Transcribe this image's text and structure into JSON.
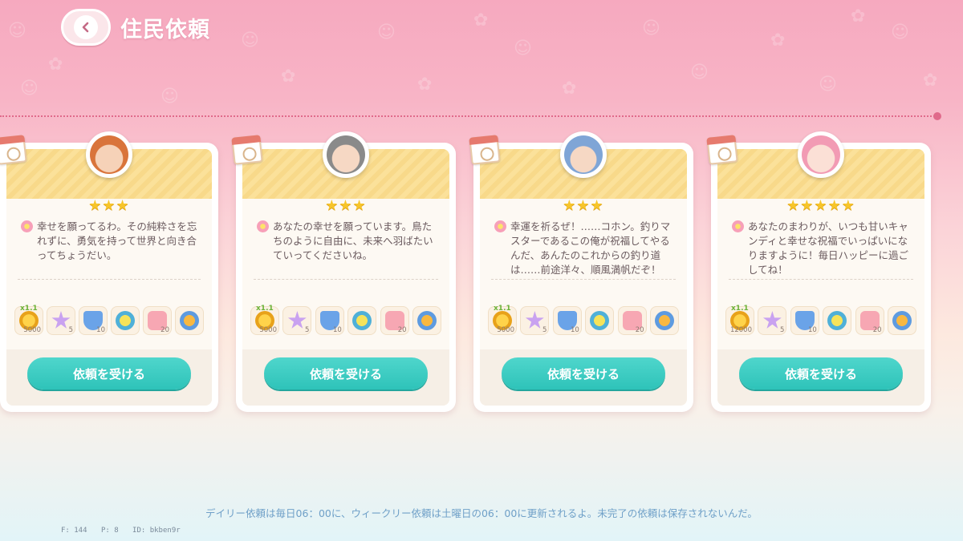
{
  "header": {
    "title": "住民依頼"
  },
  "cards": [
    {
      "stars": "★★★",
      "message": "幸せを願ってるわ。その純粋さを忘れずに、勇気を持って世界と向き合ってちょうだい。",
      "rewards": [
        {
          "icon": "coin-icon",
          "qty": "5000",
          "mult": "x1.1"
        },
        {
          "icon": "star-icon",
          "qty": "5",
          "mult": ""
        },
        {
          "icon": "badge-icon",
          "qty": "10",
          "mult": ""
        },
        {
          "icon": "mystery-icon",
          "qty": "",
          "mult": ""
        },
        {
          "icon": "candy-icon",
          "qty": "20",
          "mult": ""
        },
        {
          "icon": "duck-icon",
          "qty": "",
          "mult": ""
        }
      ],
      "button": "依頼を受ける",
      "avatar_color": "#d9743b"
    },
    {
      "stars": "★★★",
      "message": "あなたの幸せを願っています。鳥たちのように自由に、未来へ羽ばたいていってくださいね。",
      "rewards": [
        {
          "icon": "coin-icon",
          "qty": "5000",
          "mult": "x1.1"
        },
        {
          "icon": "star-icon",
          "qty": "5",
          "mult": ""
        },
        {
          "icon": "badge-icon",
          "qty": "10",
          "mult": ""
        },
        {
          "icon": "mystery-icon",
          "qty": "",
          "mult": ""
        },
        {
          "icon": "candy-icon",
          "qty": "20",
          "mult": ""
        },
        {
          "icon": "duck-icon",
          "qty": "",
          "mult": ""
        }
      ],
      "button": "依頼を受ける",
      "avatar_color": "#8a8a8a"
    },
    {
      "stars": "★★★",
      "message": "幸運を祈るぜ！……コホン。釣りマスターであるこの俺が祝福してやるんだ、あんたのこれからの釣り道は……前途洋々、順風満帆だぞ！",
      "rewards": [
        {
          "icon": "coin-icon",
          "qty": "5000",
          "mult": "x1.1"
        },
        {
          "icon": "star-icon",
          "qty": "5",
          "mult": ""
        },
        {
          "icon": "badge-icon",
          "qty": "10",
          "mult": ""
        },
        {
          "icon": "mystery-icon",
          "qty": "",
          "mult": ""
        },
        {
          "icon": "candy-icon",
          "qty": "20",
          "mult": ""
        },
        {
          "icon": "duck-icon",
          "qty": "",
          "mult": ""
        }
      ],
      "button": "依頼を受ける",
      "avatar_color": "#7fa5d6"
    },
    {
      "stars": "★★★★★",
      "message": "あなたのまわりが、いつも甘いキャンディと幸せな祝福でいっぱいになりますように！毎日ハッピーに過ごしてね！",
      "rewards": [
        {
          "icon": "coin-icon",
          "qty": "12000",
          "mult": "x1.1"
        },
        {
          "icon": "star-icon",
          "qty": "5",
          "mult": ""
        },
        {
          "icon": "badge-icon",
          "qty": "10",
          "mult": ""
        },
        {
          "icon": "mystery-icon",
          "qty": "",
          "mult": ""
        },
        {
          "icon": "candy-icon",
          "qty": "20",
          "mult": ""
        },
        {
          "icon": "duck-icon",
          "qty": "",
          "mult": ""
        }
      ],
      "button": "依頼を受ける",
      "avatar_color": "#f29bb4"
    }
  ],
  "footer_note": "デイリー依頼は毎日06：00に、ウィークリー依頼は土曜日の06：00に更新されるよ。未完了の依頼は保存されないんだ。",
  "debug": {
    "f": "F: 144",
    "p": "P: 8",
    "id": "ID: bkben9r"
  },
  "colors": {
    "accent_button": "#2ec3b9",
    "star": "#f7c52a",
    "dotted_line": "#e06a8b"
  }
}
